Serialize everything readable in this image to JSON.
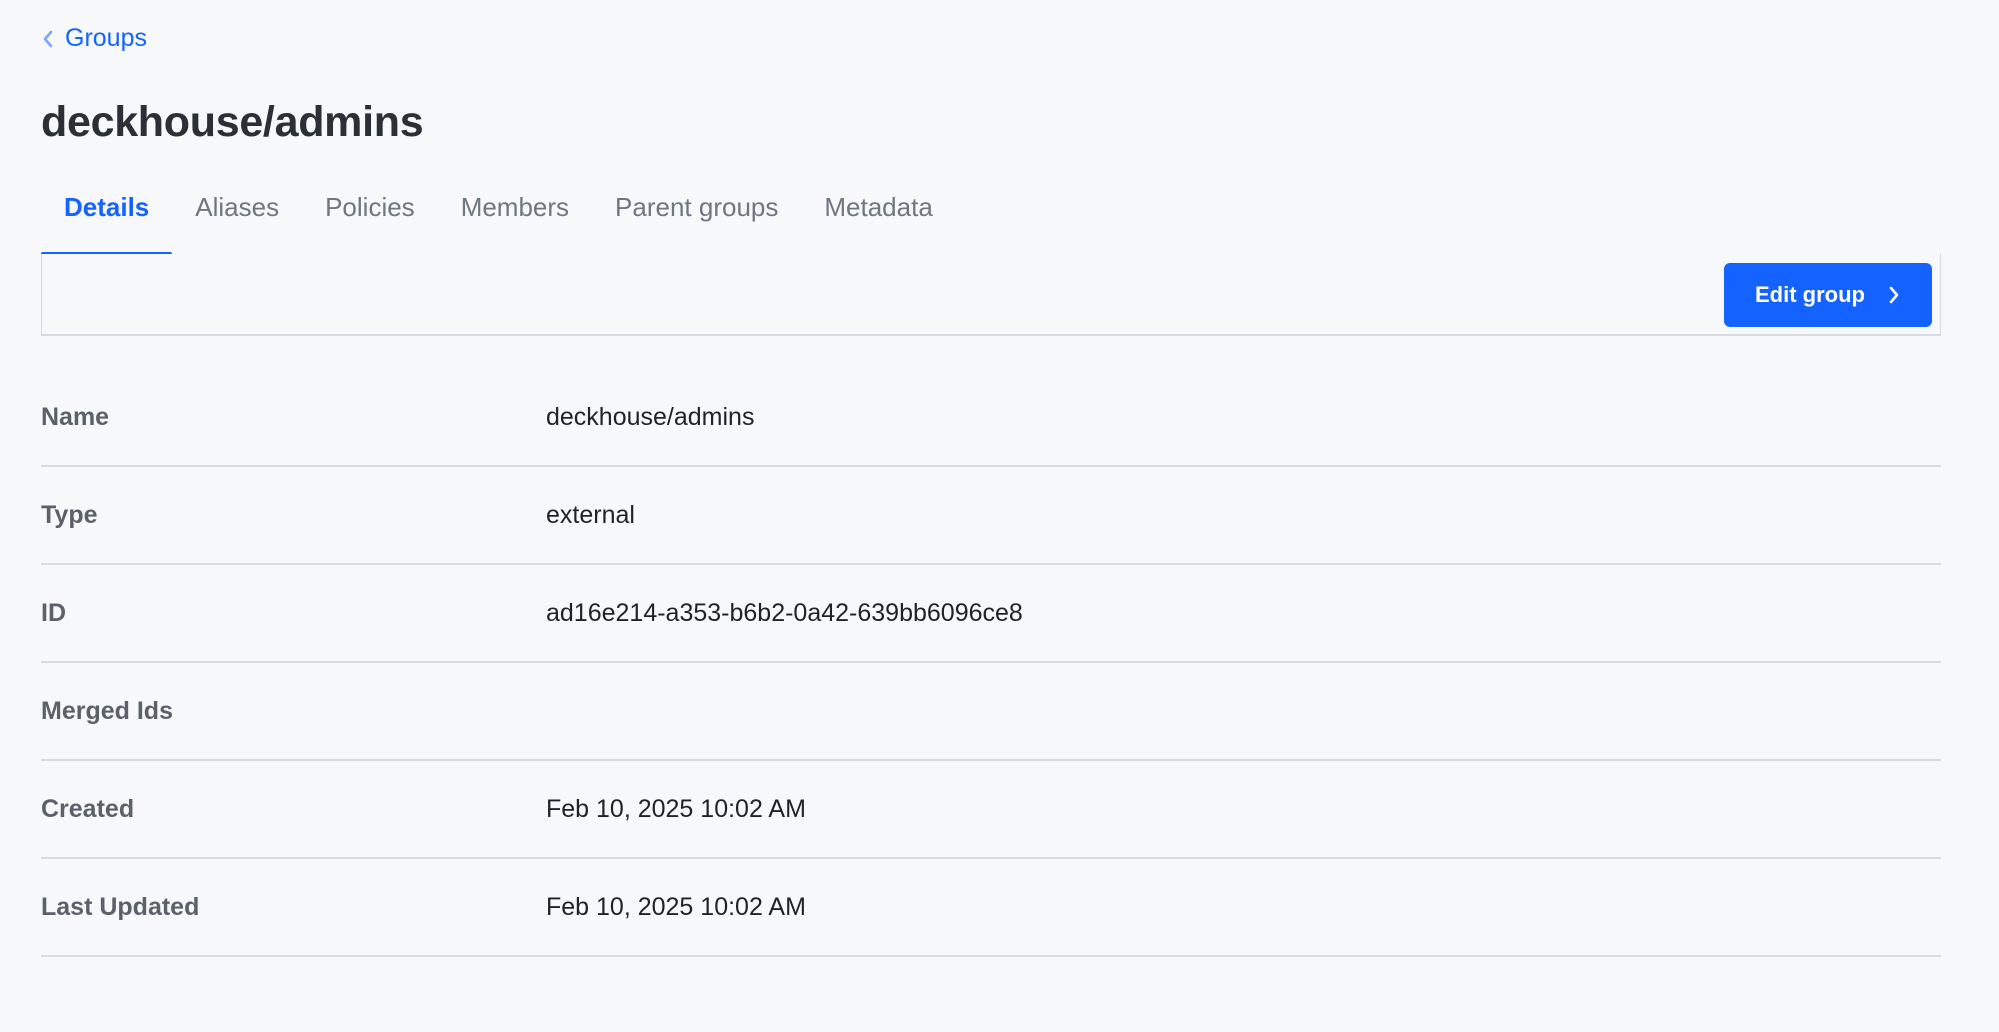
{
  "breadcrumb": {
    "label": "Groups"
  },
  "header": {
    "title": "deckhouse/admins"
  },
  "tabs": [
    {
      "label": "Details",
      "active": true
    },
    {
      "label": "Aliases",
      "active": false
    },
    {
      "label": "Policies",
      "active": false
    },
    {
      "label": "Members",
      "active": false
    },
    {
      "label": "Parent groups",
      "active": false
    },
    {
      "label": "Metadata",
      "active": false
    }
  ],
  "toolbar": {
    "edit_label": "Edit group"
  },
  "details": [
    {
      "label": "Name",
      "value": "deckhouse/admins"
    },
    {
      "label": "Type",
      "value": "external"
    },
    {
      "label": "ID",
      "value": "ad16e214-a353-b6b2-0a42-639bb6096ce8"
    },
    {
      "label": "Merged Ids",
      "value": ""
    },
    {
      "label": "Created",
      "value": "Feb 10, 2025 10:02 AM"
    },
    {
      "label": "Last Updated",
      "value": "Feb 10, 2025 10:02 AM"
    }
  ],
  "colors": {
    "accent": "#1563ff",
    "background": "#f7f8fa",
    "border": "#d6dbe1"
  },
  "icons": {
    "breadcrumb": "chevron-left-icon",
    "edit_button": "chevron-right-icon"
  }
}
